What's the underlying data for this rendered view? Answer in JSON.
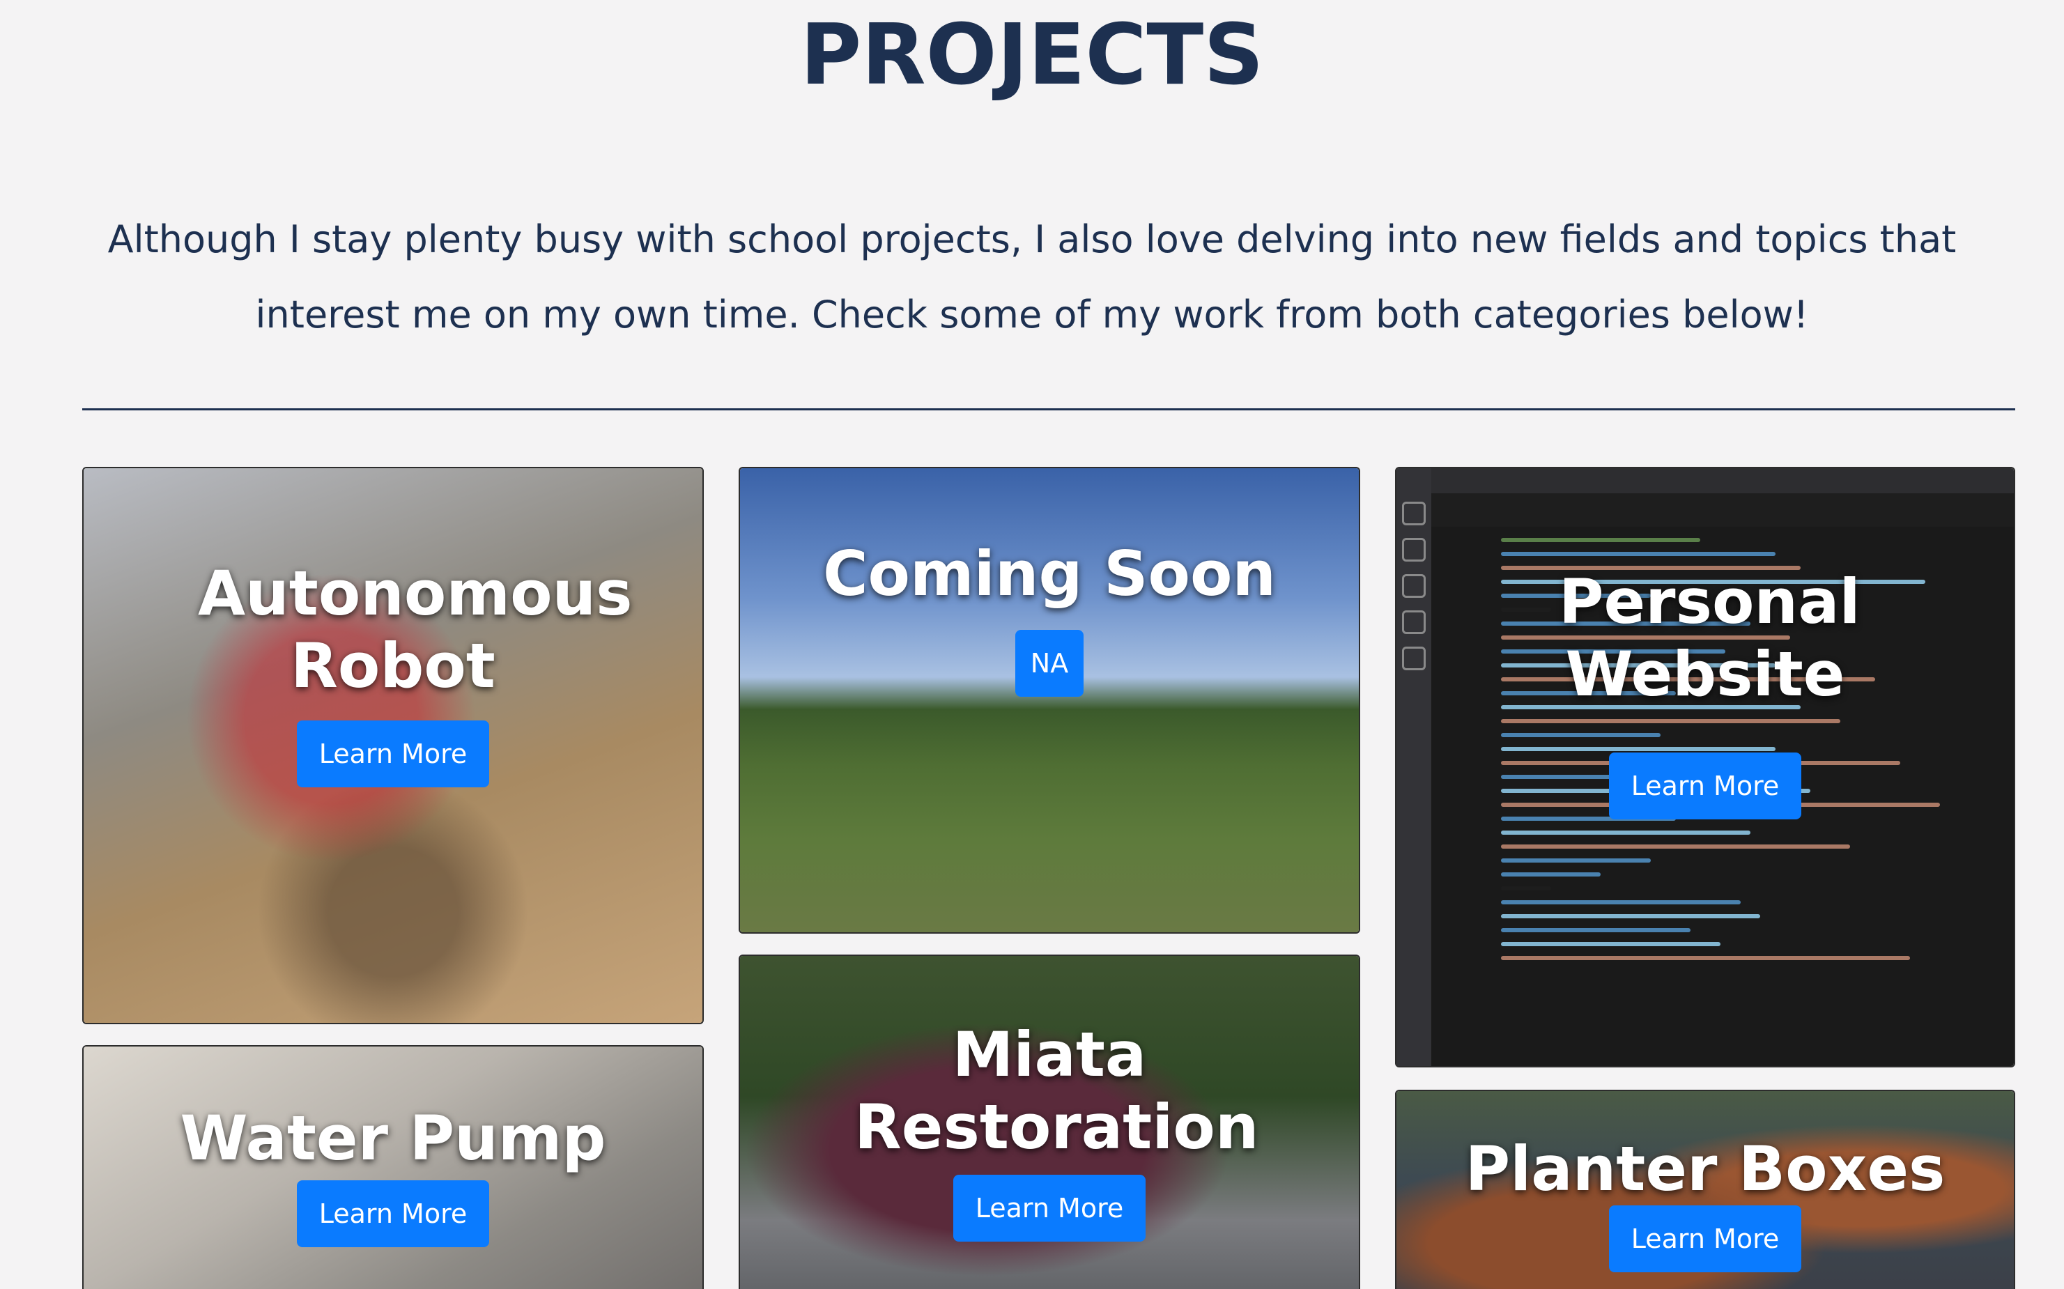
{
  "header": {
    "title": "PROJECTS",
    "intro": "Although I stay plenty busy with school projects, I also love delving into new fields and topics that interest me on my own time. Check some of my work from both categories below!"
  },
  "projects": [
    {
      "title": "Autonomous Robot",
      "button": "Learn More"
    },
    {
      "title": "Coming Soon",
      "badge": "NA"
    },
    {
      "title": "Personal Website",
      "button": "Learn More"
    },
    {
      "title": "Water Pump",
      "button": "Learn More"
    },
    {
      "title": "Miata Restoration",
      "button": "Learn More"
    },
    {
      "title": "Planter Boxes",
      "button": "Learn More"
    }
  ],
  "colors": {
    "heading": "#1d3050",
    "button": "#0a7bff",
    "background": "#f4f3f4"
  }
}
